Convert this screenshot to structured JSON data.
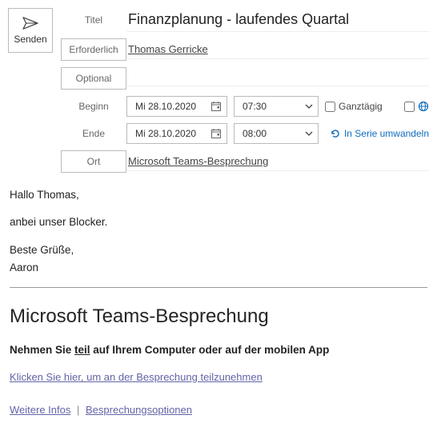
{
  "send": {
    "label": "Senden"
  },
  "labels": {
    "title": "Titel",
    "required": "Erforderlich",
    "optional": "Optional",
    "begin": "Beginn",
    "end": "Ende",
    "location": "Ort",
    "allday": "Ganztägig"
  },
  "values": {
    "title": "Finanzplanung - laufendes Quartal",
    "required": "Thomas Gerricke",
    "begin_date": "Mi 28.10.2020",
    "begin_time": "07:30",
    "end_date": "Mi 28.10.2020",
    "end_time": "08:00",
    "location": "Microsoft Teams-Besprechung"
  },
  "series": {
    "label": "In Serie umwandeln"
  },
  "body": {
    "greeting": "Hallo Thomas,",
    "line1": "anbei unser Blocker.",
    "closing": "Beste Grüße,",
    "signature": "Aaron"
  },
  "teams": {
    "heading": "Microsoft Teams-Besprechung",
    "sub_prefix": "Nehmen Sie ",
    "sub_underline": "teil",
    "sub_suffix": " auf Ihrem Computer oder auf der mobilen App",
    "join_link": "Klicken Sie hier, um an der Besprechung teilzunehmen",
    "more_info": "Weitere Infos",
    "options": "Besprechungsoptionen"
  }
}
